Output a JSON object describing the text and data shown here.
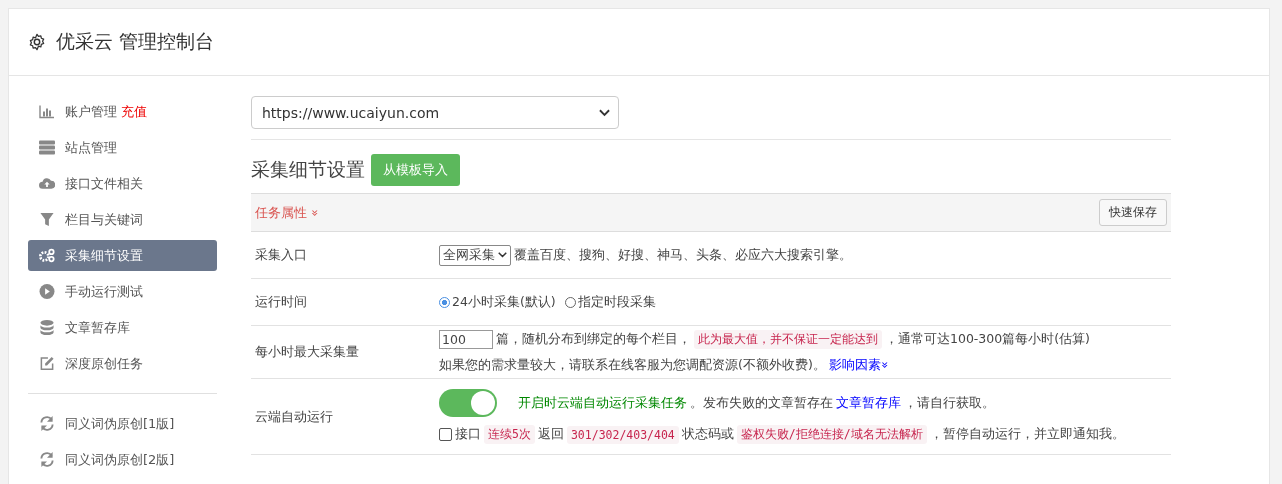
{
  "header": {
    "title": "优采云 管理控制台"
  },
  "sidebar": {
    "items": [
      {
        "label": "账户管理",
        "badge": "充值",
        "selected": false
      },
      {
        "label": "站点管理",
        "selected": false
      },
      {
        "label": "接口文件相关",
        "selected": false
      },
      {
        "label": "栏目与关键词",
        "selected": false
      },
      {
        "label": "采集细节设置",
        "selected": true
      },
      {
        "label": "手动运行测试",
        "selected": false
      },
      {
        "label": "文章暂存库",
        "selected": false
      },
      {
        "label": "深度原创任务",
        "selected": false
      },
      {
        "label": "同义词伪原创[1版]",
        "selected": false,
        "divider_before": true
      },
      {
        "label": "同义词伪原创[2版]",
        "selected": false
      }
    ]
  },
  "site_select": {
    "value": "https://www.ucaiyun.com"
  },
  "section": {
    "title": "采集细节设置",
    "import_button": "从模板导入"
  },
  "panel": {
    "title": "任务属性",
    "title_icon": "»",
    "save_button": "快速保存"
  },
  "rows": [
    {
      "kind": "select",
      "label": "采集入口",
      "value": "全网采集",
      "note": "覆盖百度、搜狗、好搜、神马、头条、必应六大搜索引擎。"
    },
    {
      "kind": "radio",
      "label": "运行时间",
      "options": [
        {
          "label": "24小时采集(默认)",
          "selected": true
        },
        {
          "label": "指定时段采集",
          "selected": false
        }
      ]
    },
    {
      "kind": "quantity",
      "label": "每小时最大采集量",
      "value": "100",
      "parts": [
        {
          "text": "篇，随机分布到绑定的每个栏目，",
          "code": false
        },
        {
          "text": "此为最大值，并不保证一定能达到",
          "code": true
        },
        {
          "text": "，通常可达100-300篇每小时(估算)",
          "code": false
        }
      ],
      "note": "如果您的需求量较大，请联系在线客服为您调配资源(不额外收费)。",
      "link": "影响因素",
      "link_icon": "»"
    },
    {
      "kind": "toggle",
      "label": "云端自动运行",
      "on": true,
      "status": "开启时云端自动运行采集任务",
      "note": "。发布失败的文章暂存在",
      "link": "文章暂存库",
      "note_end": "，请自行获取。",
      "checked": false,
      "parts": [
        {
          "text": "接口",
          "code": false
        },
        {
          "text": "连续5次",
          "code": true
        },
        {
          "text": "返回",
          "code": false
        },
        {
          "text": "301/302/403/404",
          "code": true
        },
        {
          "text": "状态码或",
          "code": false
        },
        {
          "text": "鉴权失败/拒绝连接/域名无法解析",
          "code": true
        },
        {
          "text": "，暂停自动运行，并立即通知我。",
          "code": false
        }
      ]
    }
  ]
}
